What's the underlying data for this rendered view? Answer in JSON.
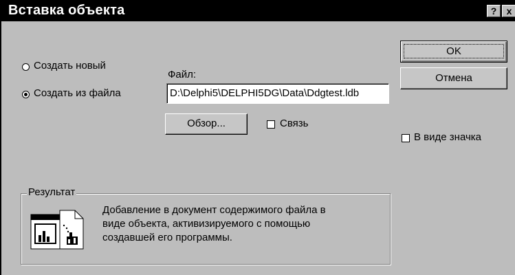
{
  "window": {
    "title": "Вставка объекта",
    "help_label": "?",
    "close_label": "x"
  },
  "options": {
    "create_new_label": "Создать новый",
    "create_from_file_label": "Создать из файла",
    "selected": "create_from_file"
  },
  "file": {
    "label": "Файл:",
    "value": "D:\\Delphi5\\DELPHI5DG\\Data\\Ddgtest.ldb"
  },
  "buttons": {
    "ok_label": "OK",
    "cancel_label": "Отмена",
    "browse_label": "Обзор..."
  },
  "link": {
    "label": "Связь",
    "checked": false
  },
  "display_as_icon": {
    "label": "В виде значка",
    "checked": false
  },
  "result": {
    "title": "Результат",
    "text": "Добавление в документ содержимого файла в\nвиде объекта, активизируемого с помощью\nсоздавшей его программы.",
    "icon": "insert-file-object-icon"
  }
}
